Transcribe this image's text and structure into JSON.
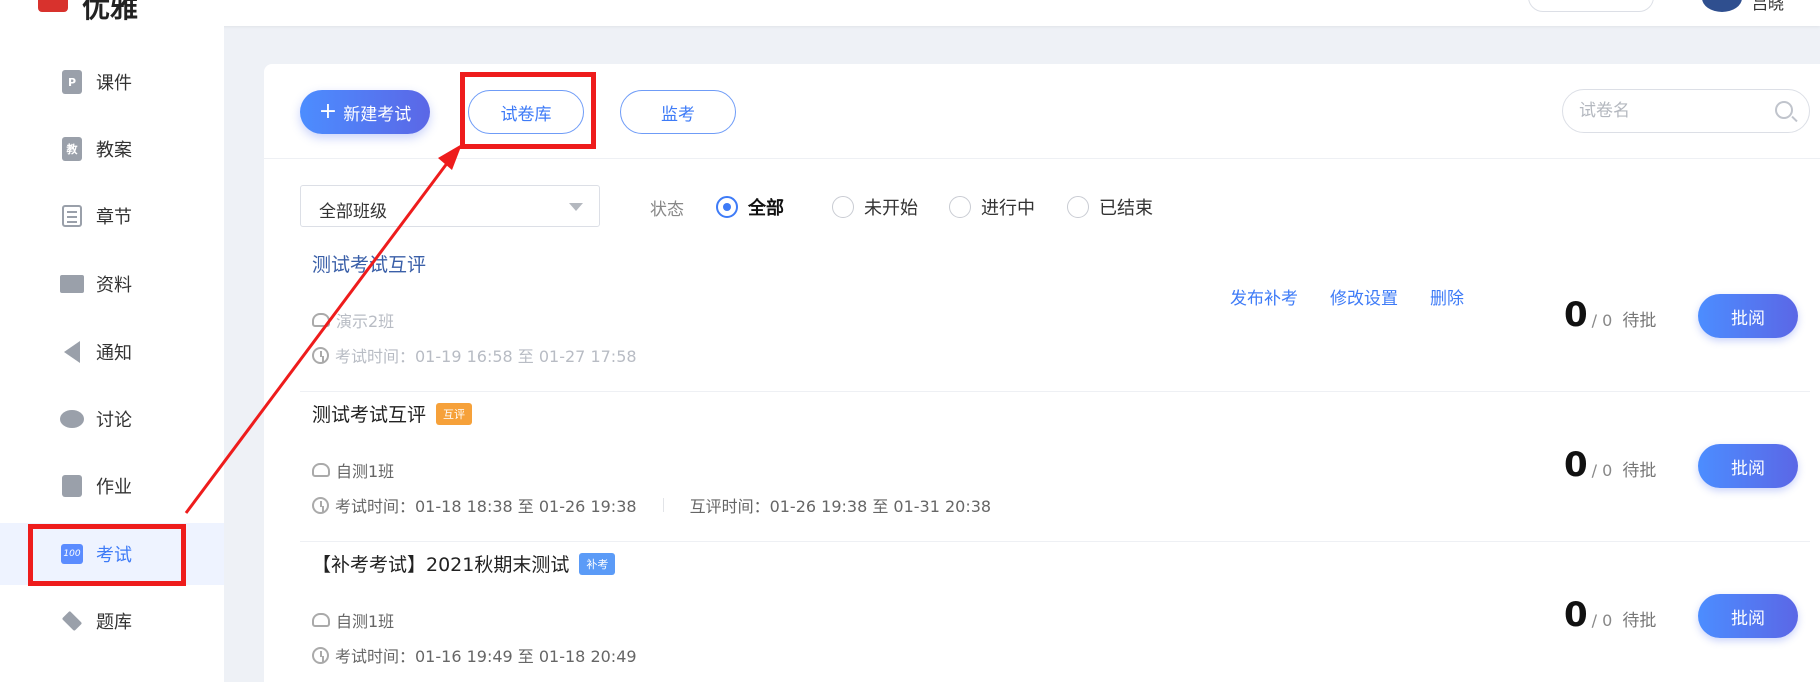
{
  "header": {
    "logo_text": "优雅",
    "user_name": "吕晓"
  },
  "sidebar": {
    "items": [
      {
        "label": "课件",
        "icon": "doc-p-icon"
      },
      {
        "label": "教案",
        "icon": "doc-jiao-icon"
      },
      {
        "label": "章节",
        "icon": "list-icon"
      },
      {
        "label": "资料",
        "icon": "folder-icon"
      },
      {
        "label": "通知",
        "icon": "speaker-icon"
      },
      {
        "label": "讨论",
        "icon": "chat-bubble-icon"
      },
      {
        "label": "作业",
        "icon": "edit-icon"
      },
      {
        "label": "考试",
        "icon": "score-100-icon",
        "active": true
      },
      {
        "label": "题库",
        "icon": "stack-icon"
      }
    ]
  },
  "toolbar": {
    "new_exam_label": "新建考试",
    "paper_bank_label": "试卷库",
    "proctor_label": "监考",
    "search_placeholder": "试卷名"
  },
  "filters": {
    "class_select_value": "全部班级",
    "status_label": "状态",
    "status_options": [
      "全部",
      "未开始",
      "进行中",
      "已结束"
    ],
    "status_selected": "全部"
  },
  "exams": [
    {
      "title": "测试考试互评",
      "tag": "",
      "class": "演示2班",
      "exam_time": "考试时间：01-19 16:58 至 01-27 17:58",
      "peer_time": "",
      "actions": [
        "发布补考",
        "修改设置",
        "删除"
      ],
      "count_done": "0",
      "count_total": "/ 0",
      "pending_label": "待批",
      "review_label": "批阅"
    },
    {
      "title": "测试考试互评",
      "tag": "互评",
      "class": "自测1班",
      "exam_time": "考试时间：01-18 18:38 至 01-26 19:38",
      "peer_time": "互评时间：01-26 19:38 至 01-31 20:38",
      "actions": [],
      "count_done": "0",
      "count_total": "/ 0",
      "pending_label": "待批",
      "review_label": "批阅"
    },
    {
      "title": "【补考考试】2021秋期末测试",
      "tag": "补考",
      "class": "自测1班",
      "exam_time": "考试时间：01-16 19:49 至 01-18 20:49",
      "peer_time": "",
      "actions": [],
      "count_done": "0",
      "count_total": "/ 0",
      "pending_label": "待批",
      "review_label": "批阅"
    }
  ],
  "colors": {
    "accent": "#3e7bf7",
    "annotation": "#ee1c1c",
    "tag_peer": "#f6a13a",
    "tag_makeup": "#5b9bf7"
  }
}
